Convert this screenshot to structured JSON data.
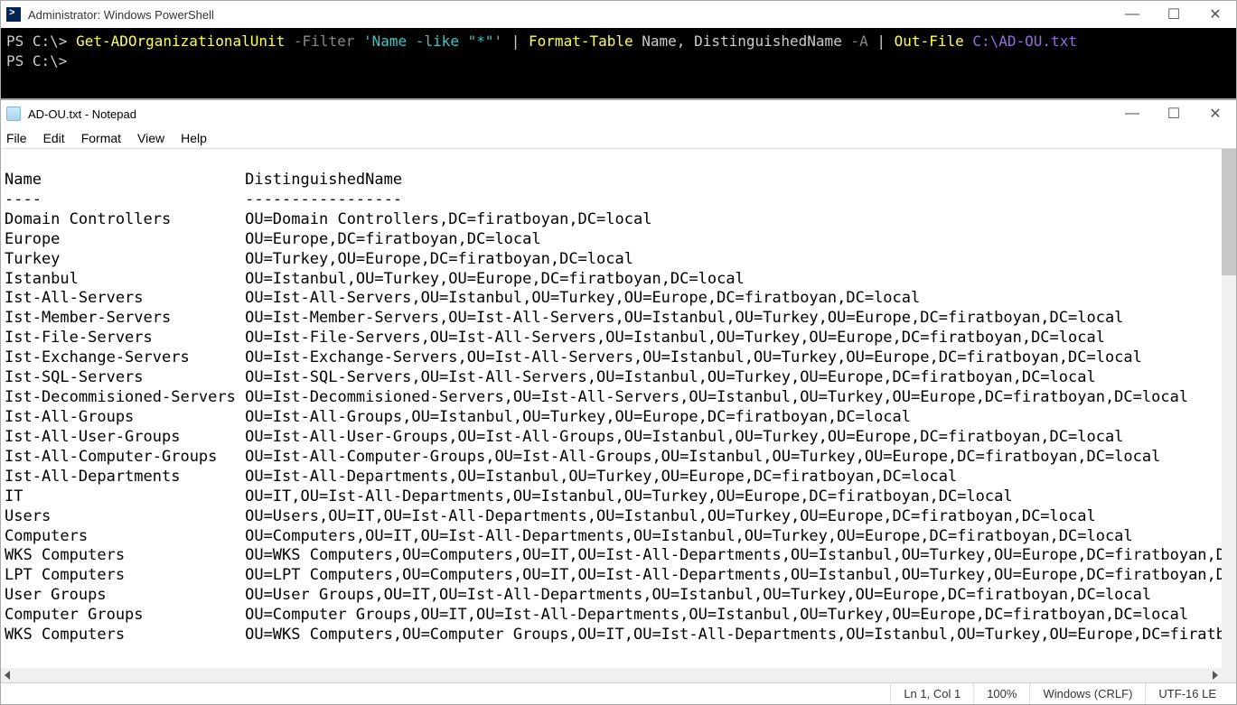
{
  "powershell": {
    "title": "Administrator: Windows PowerShell",
    "prompt1": "PS C:\\>",
    "prompt2": "PS C:\\>",
    "cmd": {
      "get": "Get-ADOrganizationalUnit",
      "filterFlag": "-Filter",
      "filterStr": "'Name -like \"*\"'",
      "pipe": "|",
      "ft": "Format-Table",
      "ftArgs": "Name, DistinguishedName",
      "aFlag": "-A",
      "pipe2": "|",
      "of": "Out-File",
      "path": "C:\\AD-OU.txt"
    }
  },
  "notepad": {
    "title": "AD-OU.txt - Notepad",
    "menu": {
      "file": "File",
      "edit": "Edit",
      "format": "Format",
      "view": "View",
      "help": "Help"
    },
    "status": {
      "pos": "Ln 1, Col 1",
      "zoom": "100%",
      "eol": "Windows (CRLF)",
      "enc": "UTF-16 LE"
    },
    "headerName": "Name",
    "headerDN": "DistinguishedName",
    "sepName": "----",
    "sepDN": "-----------------",
    "rows": [
      {
        "n": "Domain Controllers",
        "d": "OU=Domain Controllers,DC=firatboyan,DC=local"
      },
      {
        "n": "Europe",
        "d": "OU=Europe,DC=firatboyan,DC=local"
      },
      {
        "n": "Turkey",
        "d": "OU=Turkey,OU=Europe,DC=firatboyan,DC=local"
      },
      {
        "n": "Istanbul",
        "d": "OU=Istanbul,OU=Turkey,OU=Europe,DC=firatboyan,DC=local"
      },
      {
        "n": "Ist-All-Servers",
        "d": "OU=Ist-All-Servers,OU=Istanbul,OU=Turkey,OU=Europe,DC=firatboyan,DC=local"
      },
      {
        "n": "Ist-Member-Servers",
        "d": "OU=Ist-Member-Servers,OU=Ist-All-Servers,OU=Istanbul,OU=Turkey,OU=Europe,DC=firatboyan,DC=local"
      },
      {
        "n": "Ist-File-Servers",
        "d": "OU=Ist-File-Servers,OU=Ist-All-Servers,OU=Istanbul,OU=Turkey,OU=Europe,DC=firatboyan,DC=local"
      },
      {
        "n": "Ist-Exchange-Servers",
        "d": "OU=Ist-Exchange-Servers,OU=Ist-All-Servers,OU=Istanbul,OU=Turkey,OU=Europe,DC=firatboyan,DC=local"
      },
      {
        "n": "Ist-SQL-Servers",
        "d": "OU=Ist-SQL-Servers,OU=Ist-All-Servers,OU=Istanbul,OU=Turkey,OU=Europe,DC=firatboyan,DC=local"
      },
      {
        "n": "Ist-Decommisioned-Servers",
        "d": "OU=Ist-Decommisioned-Servers,OU=Ist-All-Servers,OU=Istanbul,OU=Turkey,OU=Europe,DC=firatboyan,DC=local"
      },
      {
        "n": "Ist-All-Groups",
        "d": "OU=Ist-All-Groups,OU=Istanbul,OU=Turkey,OU=Europe,DC=firatboyan,DC=local"
      },
      {
        "n": "Ist-All-User-Groups",
        "d": "OU=Ist-All-User-Groups,OU=Ist-All-Groups,OU=Istanbul,OU=Turkey,OU=Europe,DC=firatboyan,DC=local"
      },
      {
        "n": "Ist-All-Computer-Groups",
        "d": "OU=Ist-All-Computer-Groups,OU=Ist-All-Groups,OU=Istanbul,OU=Turkey,OU=Europe,DC=firatboyan,DC=local"
      },
      {
        "n": "Ist-All-Departments",
        "d": "OU=Ist-All-Departments,OU=Istanbul,OU=Turkey,OU=Europe,DC=firatboyan,DC=local"
      },
      {
        "n": "IT",
        "d": "OU=IT,OU=Ist-All-Departments,OU=Istanbul,OU=Turkey,OU=Europe,DC=firatboyan,DC=local"
      },
      {
        "n": "Users",
        "d": "OU=Users,OU=IT,OU=Ist-All-Departments,OU=Istanbul,OU=Turkey,OU=Europe,DC=firatboyan,DC=local"
      },
      {
        "n": "Computers",
        "d": "OU=Computers,OU=IT,OU=Ist-All-Departments,OU=Istanbul,OU=Turkey,OU=Europe,DC=firatboyan,DC=local"
      },
      {
        "n": "WKS Computers",
        "d": "OU=WKS Computers,OU=Computers,OU=IT,OU=Ist-All-Departments,OU=Istanbul,OU=Turkey,OU=Europe,DC=firatboyan,DC="
      },
      {
        "n": "LPT Computers",
        "d": "OU=LPT Computers,OU=Computers,OU=IT,OU=Ist-All-Departments,OU=Istanbul,OU=Turkey,OU=Europe,DC=firatboyan,DC="
      },
      {
        "n": "User Groups",
        "d": "OU=User Groups,OU=IT,OU=Ist-All-Departments,OU=Istanbul,OU=Turkey,OU=Europe,DC=firatboyan,DC=local"
      },
      {
        "n": "Computer Groups",
        "d": "OU=Computer Groups,OU=IT,OU=Ist-All-Departments,OU=Istanbul,OU=Turkey,OU=Europe,DC=firatboyan,DC=local"
      },
      {
        "n": "WKS Computers",
        "d": "OU=WKS Computers,OU=Computer Groups,OU=IT,OU=Ist-All-Departments,OU=Istanbul,OU=Turkey,OU=Europe,DC=firatboy"
      }
    ]
  }
}
